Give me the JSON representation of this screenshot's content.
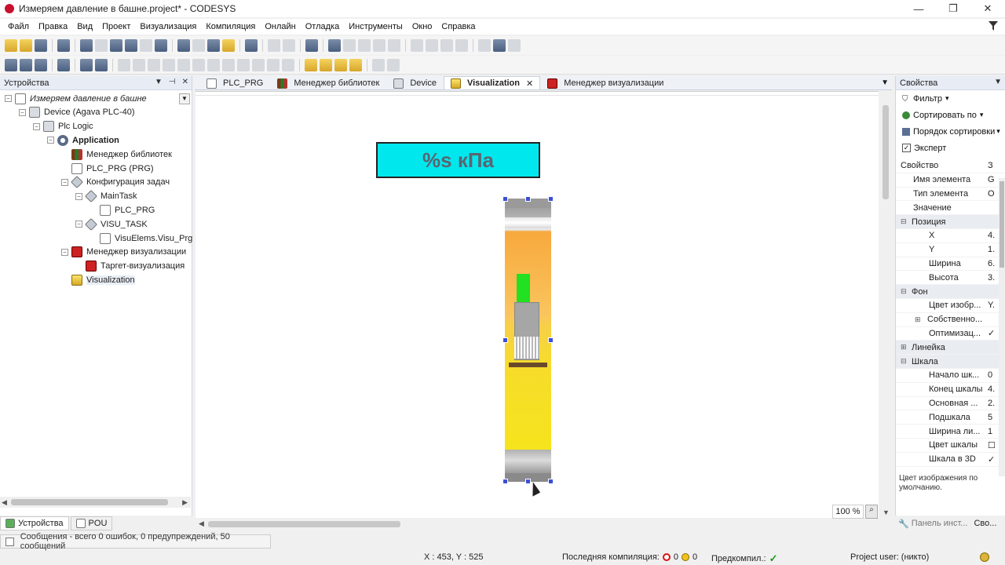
{
  "window": {
    "title": "Измеряем давление в башне.project* - CODESYS",
    "controls": [
      "—",
      "❐",
      "✕"
    ]
  },
  "menu": [
    "Файл",
    "Правка",
    "Вид",
    "Проект",
    "Визуализация",
    "Компиляция",
    "Онлайн",
    "Отладка",
    "Инструменты",
    "Окно",
    "Справка"
  ],
  "devices_panel": {
    "title": "Устройства",
    "tree": [
      {
        "label": "Измеряем давление в башне",
        "level": 0,
        "icon": "project-icon",
        "style": "italic"
      },
      {
        "label": "Device (Agava PLC-40)",
        "level": 1,
        "icon": "device-icon"
      },
      {
        "label": "Plc Logic",
        "level": 2,
        "icon": "plc-icon"
      },
      {
        "label": "Application",
        "level": 3,
        "icon": "application-gear-icon",
        "style": "bold"
      },
      {
        "label": "Менеджер библиотек",
        "level": 4,
        "icon": "library-manager-icon"
      },
      {
        "label": "PLC_PRG (PRG)",
        "level": 4,
        "icon": "program-icon"
      },
      {
        "label": "Конфигурация задач",
        "level": 4,
        "icon": "task-config-icon"
      },
      {
        "label": "MainTask",
        "level": 5,
        "icon": "task-icon"
      },
      {
        "label": "PLC_PRG",
        "level": 6,
        "icon": "program-call-icon"
      },
      {
        "label": "VISU_TASK",
        "level": 5,
        "icon": "task-icon"
      },
      {
        "label": "VisuElems.Visu_Prg",
        "level": 6,
        "icon": "program-call-icon"
      },
      {
        "label": "Менеджер визуализации",
        "level": 4,
        "icon": "visu-manager-icon"
      },
      {
        "label": "Таргет-визуализация",
        "level": 5,
        "icon": "target-visu-icon"
      },
      {
        "label": "Visualization",
        "level": 4,
        "icon": "visualization-icon",
        "selected": true
      }
    ],
    "bottom_tabs": [
      "Устройства",
      "POU"
    ]
  },
  "editor_tabs": [
    {
      "label": "PLC_PRG",
      "active": false,
      "icon": "program-icon"
    },
    {
      "label": "Менеджер библиотек",
      "active": false,
      "icon": "library-manager-icon"
    },
    {
      "label": "Device",
      "active": false,
      "icon": "device-icon"
    },
    {
      "label": "Visualization",
      "active": true,
      "icon": "visualization-icon",
      "close": "✕"
    },
    {
      "label": "Менеджер визуализации",
      "active": false,
      "icon": "visu-manager-icon"
    }
  ],
  "canvas": {
    "label_text": "%s кПа",
    "zoom": "100 %",
    "colors": {
      "label_bg": "#00e8ee",
      "gauge_top": "#f7a93d",
      "gauge_bottom": "#f2ef20",
      "indicator": "#22e022"
    }
  },
  "properties_panel": {
    "title": "Свойства",
    "tools": [
      {
        "label": "Фильтр",
        "icon": "filter-icon",
        "dropdown": "▾"
      },
      {
        "label": "Сортировать по",
        "icon": "sort-icon",
        "dropdown": "▾"
      },
      {
        "label": "Порядок сортировки",
        "icon": "sort-order-icon",
        "dropdown": "▾"
      }
    ],
    "expert": {
      "label": "Эксперт",
      "checked": "✓"
    },
    "rows": [
      {
        "key": "Свойство",
        "value": "З",
        "type": "header"
      },
      {
        "key": "Имя элемента",
        "value": "G",
        "type": "item"
      },
      {
        "key": "Тип элемента",
        "value": "O",
        "type": "item"
      },
      {
        "key": "Значение",
        "value": "",
        "type": "item"
      },
      {
        "key": "Позиция",
        "value": "",
        "type": "cat",
        "exp": "⊟"
      },
      {
        "key": "X",
        "value": "4.",
        "type": "sub"
      },
      {
        "key": "Y",
        "value": "1.",
        "type": "sub"
      },
      {
        "key": "Ширина",
        "value": "6.",
        "type": "sub"
      },
      {
        "key": "Высота",
        "value": "3.",
        "type": "sub"
      },
      {
        "key": "Фон",
        "value": "",
        "type": "cat",
        "exp": "⊟"
      },
      {
        "key": "Цвет изобр...",
        "value": "Y.",
        "type": "sub"
      },
      {
        "key": "Собственно...",
        "value": "",
        "type": "sub2",
        "exp": "⊞"
      },
      {
        "key": "Оптимизац...",
        "value": "✓",
        "type": "sub"
      },
      {
        "key": "Линейка",
        "value": "",
        "type": "cat",
        "exp": "⊞"
      },
      {
        "key": "Шкала",
        "value": "",
        "type": "cat",
        "exp": "⊟"
      },
      {
        "key": "Начало шк...",
        "value": "0",
        "type": "sub"
      },
      {
        "key": "Конец шкалы",
        "value": "4.",
        "type": "sub"
      },
      {
        "key": "Основная ...",
        "value": "2.",
        "type": "sub"
      },
      {
        "key": "Подшкала",
        "value": "5",
        "type": "sub"
      },
      {
        "key": "Ширина ли...",
        "value": "1",
        "type": "sub"
      },
      {
        "key": "Цвет шкалы",
        "value": "☐",
        "type": "sub"
      },
      {
        "key": "Шкала в 3D",
        "value": "✓",
        "type": "sub"
      }
    ],
    "description": "Цвет изображения по умолчанию.",
    "bottom_tabs": [
      "Панель инст...",
      "Сво..."
    ]
  },
  "messages": "Сообщения - всего 0 ошибок, 0 предупреждений, 50 сообщений",
  "status": {
    "coords": "X : 453, Y : 525",
    "last_compile_label": "Последняя компиляция:",
    "errors": "0",
    "warnings": "0",
    "precompile_label": "Предкомпил.:",
    "precompile_ok": "✓",
    "project_user": "Project user: (никто)"
  }
}
